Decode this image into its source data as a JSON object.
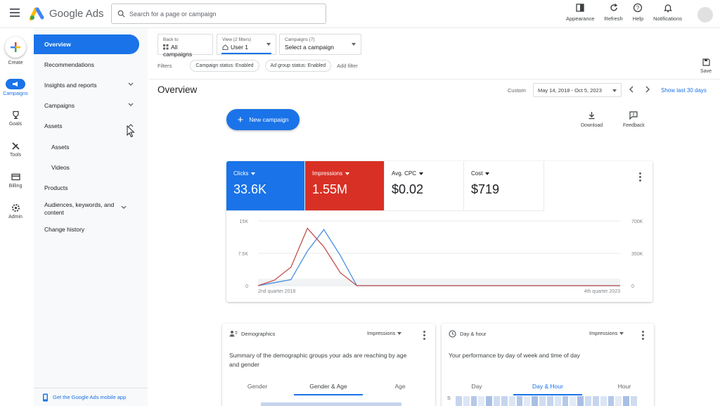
{
  "header": {
    "app_title": "Google Ads",
    "search_placeholder": "Search for a page or campaign",
    "actions": [
      {
        "label": "Appearance",
        "icon": "appearance-icon"
      },
      {
        "label": "Refresh",
        "icon": "refresh-icon"
      },
      {
        "label": "Help",
        "icon": "help-icon"
      },
      {
        "label": "Notifications",
        "icon": "bell-icon"
      }
    ]
  },
  "rail": {
    "items": [
      {
        "label": "Create",
        "icon": "plus-icon"
      },
      {
        "label": "Campaigns",
        "icon": "megaphone-icon"
      },
      {
        "label": "Goals",
        "icon": "trophy-icon"
      },
      {
        "label": "Tools",
        "icon": "tools-icon"
      },
      {
        "label": "Billing",
        "icon": "card-icon"
      },
      {
        "label": "Admin",
        "icon": "gear-icon"
      }
    ]
  },
  "nav": {
    "items": [
      {
        "label": "Overview"
      },
      {
        "label": "Recommendations"
      },
      {
        "label": "Insights and reports"
      },
      {
        "label": "Campaigns"
      },
      {
        "label": "Assets"
      },
      {
        "label": "Assets"
      },
      {
        "label": "Videos"
      },
      {
        "label": "Products"
      },
      {
        "label": "Audiences, keywords, and content"
      },
      {
        "label": "Change history"
      }
    ],
    "footer": "Get the Google Ads mobile app"
  },
  "pickers": {
    "back": {
      "label": "Back to",
      "value": "All campaigns"
    },
    "view": {
      "label": "View (2 filters)",
      "value": "User 1"
    },
    "campaigns": {
      "label": "Campaigns (7)",
      "value": "Select a campaign"
    }
  },
  "filters": {
    "label": "Filters",
    "chips": [
      "Campaign status: Enabled",
      "Ad group status: Enabled"
    ],
    "add": "Add filter"
  },
  "save_label": "Save",
  "page": {
    "title": "Overview",
    "custom_label": "Custom",
    "date_range": "May 14, 2018 - Oct 5, 2023",
    "show_last": "Show last 30 days"
  },
  "buttons": {
    "new_campaign": "New campaign",
    "download": "Download",
    "feedback": "Feedback"
  },
  "metrics": [
    {
      "label": "Clicks",
      "value": "33.6K",
      "bg": "#1a73e8",
      "fg": "#ffffff"
    },
    {
      "label": "Impressions",
      "value": "1.55M",
      "bg": "#d93025",
      "fg": "#ffffff"
    },
    {
      "label": "Avg. CPC",
      "value": "$0.02",
      "bg": "#ffffff",
      "fg": "#202124"
    },
    {
      "label": "Cost",
      "value": "$719",
      "bg": "#ffffff",
      "fg": "#202124"
    }
  ],
  "chart_data": {
    "type": "line",
    "x": [
      0,
      1,
      2,
      3,
      4,
      5,
      6,
      7,
      8,
      9,
      10,
      11,
      12,
      13,
      14,
      15,
      16,
      17,
      18,
      19,
      20,
      21,
      22
    ],
    "x_tick_labels": [
      "2nd quarter 2018",
      "4th quarter 2023"
    ],
    "left_axis": {
      "ticks": [
        "15K",
        "7.5K",
        "0"
      ],
      "ylim": [
        0,
        15000
      ]
    },
    "right_axis": {
      "ticks": [
        "700K",
        "350K",
        "0"
      ],
      "ylim": [
        0,
        700000
      ]
    },
    "series": [
      {
        "color": "#4a90e2",
        "axis": "left",
        "values": [
          0,
          700,
          1400,
          8000,
          13000,
          7000,
          0,
          0,
          0,
          0,
          0,
          0,
          0,
          0,
          0,
          0,
          0,
          0,
          0,
          0,
          0,
          0,
          0
        ]
      },
      {
        "color": "#c0504d",
        "axis": "right",
        "values": [
          0,
          60000,
          200000,
          620000,
          420000,
          140000,
          0,
          0,
          0,
          0,
          0,
          0,
          0,
          0,
          0,
          0,
          0,
          0,
          0,
          0,
          0,
          0,
          0
        ]
      }
    ],
    "grid": true
  },
  "demographics": {
    "title": "Demographics",
    "metric": "Impressions",
    "description_1": "Summary of the demographic groups your ads are reaching by age",
    "description_2": "and gender",
    "tabs": [
      "Gender",
      "Gender & Age",
      "Age"
    ]
  },
  "dayhour": {
    "title": "Day & hour",
    "metric": "Impressions",
    "description": "Your performance by day of week and time of day",
    "tabs": [
      "Day",
      "Day & Hour",
      "Hour"
    ],
    "row_label": "S"
  }
}
